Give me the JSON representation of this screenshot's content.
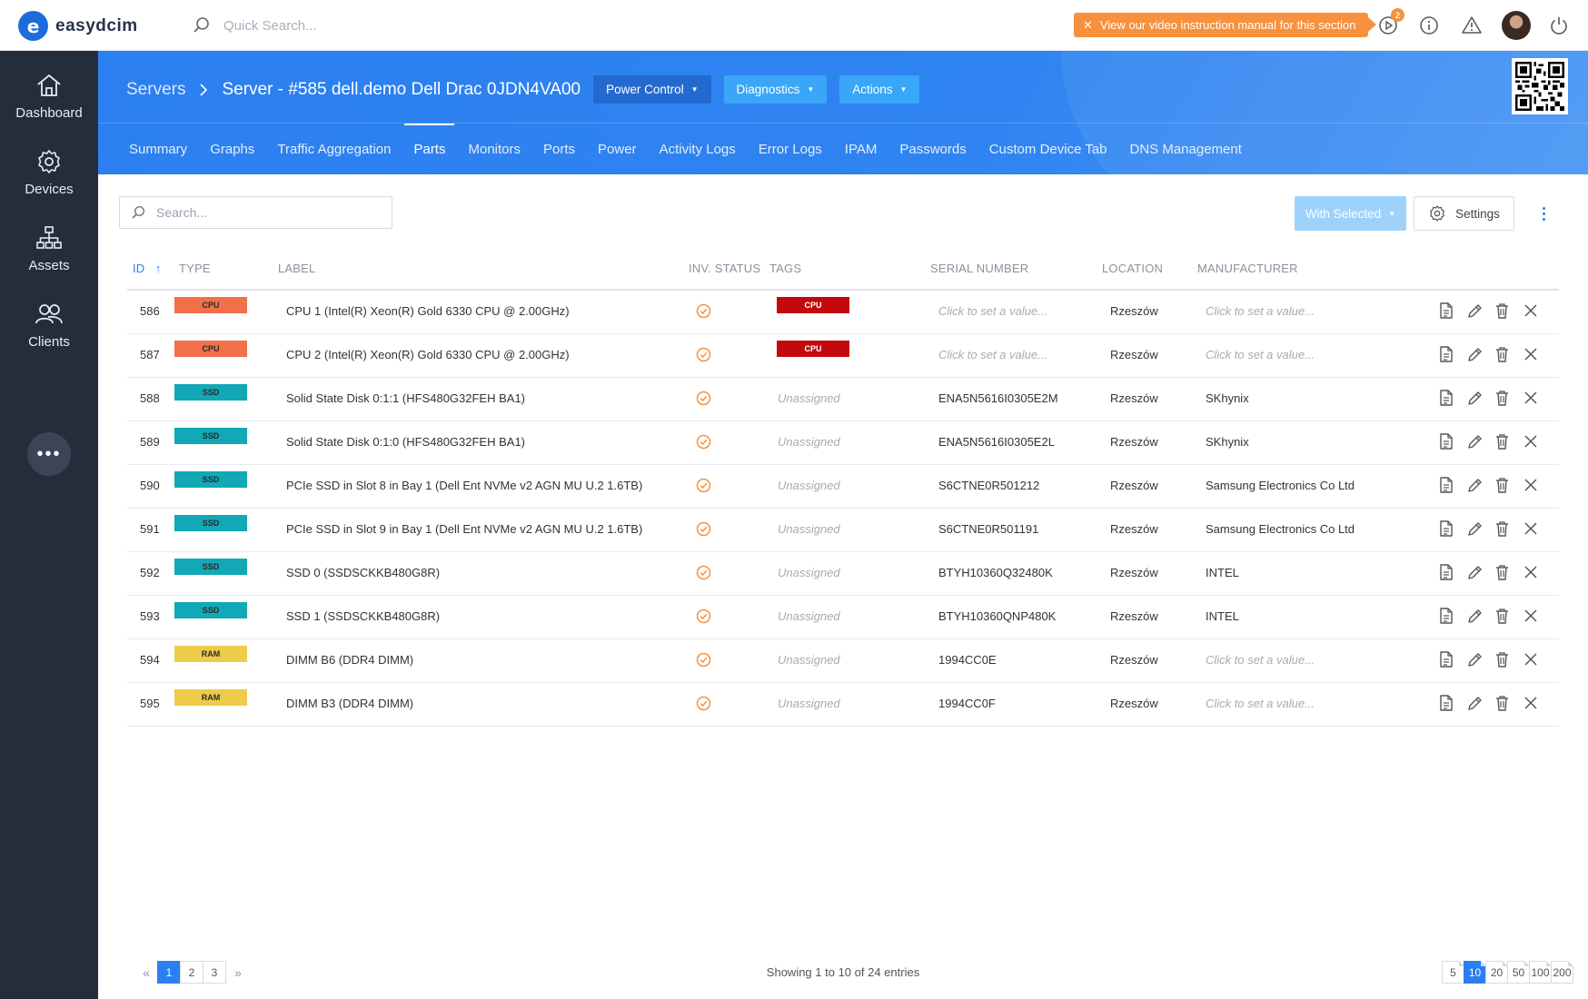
{
  "app": {
    "name": "easydcim"
  },
  "topbar": {
    "quick_search": "Quick Search...",
    "promo": "View our video instruction manual for this section",
    "notif_count": "2"
  },
  "sidebar": {
    "items": [
      {
        "label": "Dashboard"
      },
      {
        "label": "Devices"
      },
      {
        "label": "Assets"
      },
      {
        "label": "Clients"
      }
    ],
    "more": "•••"
  },
  "header": {
    "breadcrumb_root": "Servers",
    "title": "Server - #585 dell.demo Dell Drac 0JDN4VA00",
    "buttons": {
      "power": "Power Control",
      "diagnostics": "Diagnostics",
      "actions": "Actions"
    }
  },
  "tabs": [
    "Summary",
    "Graphs",
    "Traffic Aggregation",
    "Parts",
    "Monitors",
    "Ports",
    "Power",
    "Activity Logs",
    "Error Logs",
    "IPAM",
    "Passwords",
    "Custom Device Tab",
    "DNS Management"
  ],
  "active_tab": "Parts",
  "toolbar": {
    "search_placeholder": "Search...",
    "with_selected": "With Selected",
    "settings": "Settings"
  },
  "table": {
    "columns": {
      "id": "ID",
      "type": "TYPE",
      "label": "LABEL",
      "inv_status": "INV. STATUS",
      "tags": "TAGS",
      "serial": "SERIAL NUMBER",
      "location": "LOCATION",
      "manufacturer": "MANUFACTURER"
    },
    "type_colors": {
      "CPU": "#f0704a",
      "SSD": "#12a8b5",
      "RAM": "#eecb4b"
    },
    "rows": [
      {
        "id": "586",
        "type": "CPU",
        "label": "CPU 1 (Intel(R) Xeon(R) Gold 6330 CPU @ 2.00GHz)",
        "tag": "CPU",
        "serial": "Click to set a value...",
        "serial_empty": true,
        "location": "Rzeszów",
        "manufacturer": "Click to set a value...",
        "manufacturer_empty": true
      },
      {
        "id": "587",
        "type": "CPU",
        "label": "CPU 2 (Intel(R) Xeon(R) Gold 6330 CPU @ 2.00GHz)",
        "tag": "CPU",
        "serial": "Click to set a value...",
        "serial_empty": true,
        "location": "Rzeszów",
        "manufacturer": "Click to set a value...",
        "manufacturer_empty": true
      },
      {
        "id": "588",
        "type": "SSD",
        "label": "Solid State Disk 0:1:1 (HFS480G32FEH BA1)",
        "tag": "Unassigned",
        "serial": "ENA5N5616I0305E2M",
        "location": "Rzeszów",
        "manufacturer": "SKhynix"
      },
      {
        "id": "589",
        "type": "SSD",
        "label": "Solid State Disk 0:1:0 (HFS480G32FEH BA1)",
        "tag": "Unassigned",
        "serial": "ENA5N5616I0305E2L",
        "location": "Rzeszów",
        "manufacturer": "SKhynix"
      },
      {
        "id": "590",
        "type": "SSD",
        "label": "PCIe SSD in Slot 8 in Bay 1 (Dell Ent NVMe v2 AGN MU U.2 1.6TB)",
        "tag": "Unassigned",
        "serial": "S6CTNE0R501212",
        "location": "Rzeszów",
        "manufacturer": "Samsung Electronics Co Ltd"
      },
      {
        "id": "591",
        "type": "SSD",
        "label": "PCIe SSD in Slot 9 in Bay 1 (Dell Ent NVMe v2 AGN MU U.2 1.6TB)",
        "tag": "Unassigned",
        "serial": "S6CTNE0R501191",
        "location": "Rzeszów",
        "manufacturer": "Samsung Electronics Co Ltd"
      },
      {
        "id": "592",
        "type": "SSD",
        "label": "SSD 0 (SSDSCKKB480G8R)",
        "tag": "Unassigned",
        "serial": "BTYH10360Q32480K",
        "location": "Rzeszów",
        "manufacturer": "INTEL"
      },
      {
        "id": "593",
        "type": "SSD",
        "label": "SSD 1 (SSDSCKKB480G8R)",
        "tag": "Unassigned",
        "serial": "BTYH10360QNP480K",
        "location": "Rzeszów",
        "manufacturer": "INTEL"
      },
      {
        "id": "594",
        "type": "RAM",
        "label": "DIMM B6 (DDR4 DIMM)",
        "tag": "Unassigned",
        "serial": "1994CC0E",
        "location": "Rzeszów",
        "manufacturer": "Click to set a value...",
        "manufacturer_empty": true
      },
      {
        "id": "595",
        "type": "RAM",
        "label": "DIMM B3 (DDR4 DIMM)",
        "tag": "Unassigned",
        "serial": "1994CC0F",
        "location": "Rzeszów",
        "manufacturer": "Click to set a value...",
        "manufacturer_empty": true
      }
    ]
  },
  "footer": {
    "pages": [
      "1",
      "2",
      "3"
    ],
    "current_page": "1",
    "showing": "Showing 1 to 10 of 24 entries",
    "page_sizes": [
      "5",
      "10",
      "20",
      "50",
      "100",
      "200"
    ],
    "current_size": "10"
  }
}
